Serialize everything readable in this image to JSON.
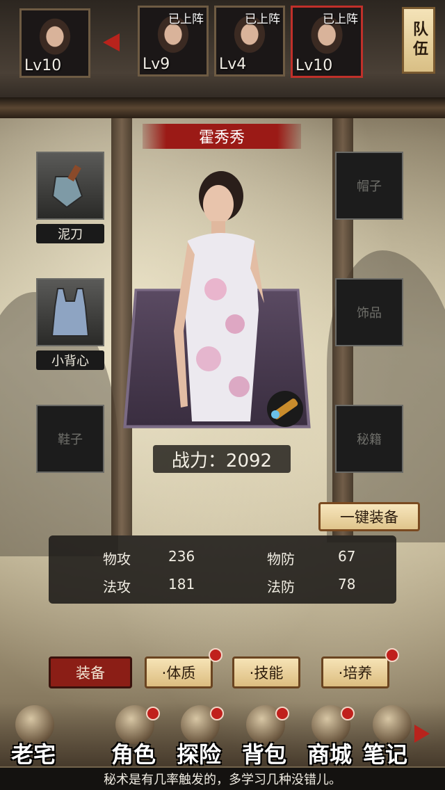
{
  "team": {
    "leader": {
      "level": "Lv10"
    },
    "members": [
      {
        "status": "已上阵",
        "level": "Lv9"
      },
      {
        "status": "已上阵",
        "level": "Lv4"
      },
      {
        "status": "已上阵",
        "level": "Lv10",
        "selected": true
      }
    ],
    "team_button_label": "队伍"
  },
  "character": {
    "name": "霍秀秀",
    "power_text": "战力：2092"
  },
  "equipment": {
    "weapon": {
      "label": "泥刀",
      "icon": "trowel-icon"
    },
    "armor": {
      "label": "小背心",
      "icon": "vest-icon"
    },
    "shoes_placeholder": "鞋子",
    "hat_placeholder": "帽子",
    "accessory_placeholder": "饰品",
    "manual_placeholder": "秘籍",
    "zoom_icon": "spyglass-icon"
  },
  "one_click_equip_label": "一键装备",
  "stats": {
    "phys_atk_label": "物攻",
    "phys_atk": "236",
    "phys_def_label": "物防",
    "phys_def": "67",
    "mag_atk_label": "法攻",
    "mag_atk": "181",
    "mag_def_label": "法防",
    "mag_def": "78"
  },
  "tabs": [
    {
      "label": "装备",
      "active": true,
      "badge": false
    },
    {
      "label": "·体质",
      "active": false,
      "badge": true
    },
    {
      "label": "·技能",
      "active": false,
      "badge": false
    },
    {
      "label": "·培养",
      "active": false,
      "badge": true
    }
  ],
  "nav": [
    {
      "label": "老宅",
      "icon": "mansion-icon",
      "badge": false
    },
    {
      "label": "角色",
      "icon": "characters-icon",
      "badge": true
    },
    {
      "label": "探险",
      "icon": "explore-icon",
      "badge": true
    },
    {
      "label": "背包",
      "icon": "backpack-icon",
      "badge": true
    },
    {
      "label": "商城",
      "icon": "shop-icon",
      "badge": true
    },
    {
      "label": "笔记",
      "icon": "notes-icon",
      "badge": false
    }
  ],
  "tip": "秘术是有几率触发的，多学习几种没错儿。",
  "colors": {
    "accent_red": "#9b1a16",
    "button_gold": "#e0c58c"
  }
}
